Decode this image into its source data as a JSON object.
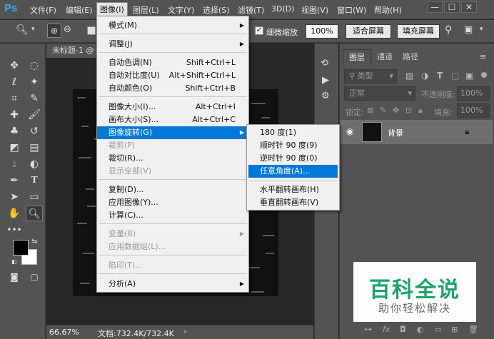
{
  "app": {
    "logo": "Ps"
  },
  "menubar": {
    "items": [
      "文件(F)",
      "编辑(E)",
      "图像(I)",
      "图层(L)",
      "文字(Y)",
      "选择(S)",
      "滤镜(T)",
      "3D(D)",
      "视图(V)",
      "窗口(W)",
      "帮助(H)"
    ],
    "window_controls": [
      "—",
      "☐",
      "✕"
    ]
  },
  "options": {
    "fine_zoom_label": "细微缩放",
    "zoom_value": "100%",
    "fit_screen": "适合屏幕",
    "fill_screen": "填充屏幕"
  },
  "document": {
    "tab_title": "未标题-1 @",
    "zoom": "66.67%",
    "doc_info": "文档:732.4K/732.4K"
  },
  "image_menu": {
    "items": [
      {
        "label": "模式(M)",
        "shortcut": "",
        "arrow": true,
        "disabled": false,
        "highlight": false
      },
      {
        "label": "调整(J)",
        "shortcut": "",
        "arrow": true,
        "disabled": false,
        "highlight": false
      },
      {
        "label": "自动色调(N)",
        "shortcut": "Shift+Ctrl+L",
        "arrow": false,
        "disabled": false,
        "highlight": false
      },
      {
        "label": "自动对比度(U)",
        "shortcut": "Alt+Shift+Ctrl+L",
        "arrow": false,
        "disabled": false,
        "highlight": false
      },
      {
        "label": "自动颜色(O)",
        "shortcut": "Shift+Ctrl+B",
        "arrow": false,
        "disabled": false,
        "highlight": false
      },
      {
        "label": "图像大小(I)...",
        "shortcut": "Alt+Ctrl+I",
        "arrow": false,
        "disabled": false,
        "highlight": false
      },
      {
        "label": "画布大小(S)...",
        "shortcut": "Alt+Ctrl+C",
        "arrow": false,
        "disabled": false,
        "highlight": false
      },
      {
        "label": "图像旋转(G)",
        "shortcut": "",
        "arrow": true,
        "disabled": false,
        "highlight": true
      },
      {
        "label": "裁剪(P)",
        "shortcut": "",
        "arrow": false,
        "disabled": true,
        "highlight": false
      },
      {
        "label": "裁切(R)...",
        "shortcut": "",
        "arrow": false,
        "disabled": false,
        "highlight": false
      },
      {
        "label": "显示全部(V)",
        "shortcut": "",
        "arrow": false,
        "disabled": true,
        "highlight": false
      },
      {
        "label": "复制(D)...",
        "shortcut": "",
        "arrow": false,
        "disabled": false,
        "highlight": false
      },
      {
        "label": "应用图像(Y)...",
        "shortcut": "",
        "arrow": false,
        "disabled": false,
        "highlight": false
      },
      {
        "label": "计算(C)...",
        "shortcut": "",
        "arrow": false,
        "disabled": false,
        "highlight": false
      },
      {
        "label": "变量(B)",
        "shortcut": "",
        "arrow": true,
        "disabled": true,
        "highlight": false
      },
      {
        "label": "应用数据组(L)...",
        "shortcut": "",
        "arrow": false,
        "disabled": true,
        "highlight": false
      },
      {
        "label": "陷印(T)...",
        "shortcut": "",
        "arrow": false,
        "disabled": true,
        "highlight": false
      },
      {
        "label": "分析(A)",
        "shortcut": "",
        "arrow": true,
        "disabled": false,
        "highlight": false
      }
    ]
  },
  "rotate_submenu": {
    "items": [
      {
        "label": "180 度(1)",
        "highlight": false
      },
      {
        "label": "顺时针 90 度(9)",
        "highlight": false
      },
      {
        "label": "逆时针 90 度(0)",
        "highlight": false
      },
      {
        "label": "任意角度(A)...",
        "highlight": true
      },
      {
        "label": "水平翻转画布(H)",
        "highlight": false
      },
      {
        "label": "垂直翻转画布(V)",
        "highlight": false
      }
    ]
  },
  "layers_panel": {
    "tabs": [
      "图层",
      "通道",
      "路径"
    ],
    "filter_kind": "类型",
    "blend_mode": "正常",
    "opacity_label": "不透明度:",
    "opacity_value": "100%",
    "lock_label": "锁定:",
    "fill_label": "填充:",
    "fill_value": "100%",
    "layer_name": "背景"
  },
  "watermark": {
    "title": "百科全说",
    "subtitle": "助你轻松解决"
  },
  "colors": {
    "accent": "#0078d7",
    "ui_dark": "#535353",
    "bg": "#282828",
    "watermark_green": "#1fa36b"
  }
}
